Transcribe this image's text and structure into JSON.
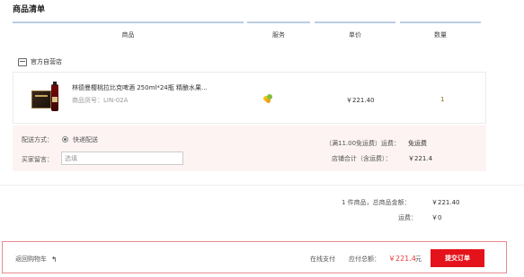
{
  "section_title": "商品清单",
  "columns": {
    "products": "商品",
    "service": "服务",
    "price": "单价",
    "qty": "数量"
  },
  "store": {
    "name": "官方自营店"
  },
  "item": {
    "name": "林德曼樱桃拉比克啤酒 250ml*24瓶 精酿水果...",
    "code": "商品货号：LIN-02A",
    "price": "￥221.40",
    "qty": "1"
  },
  "shipping": {
    "method_label": "配送方式：",
    "method_value": "快递配送",
    "memo_label": "买家留言：",
    "memo_placeholder": "选填",
    "fee_label": "（满11.00免运费）运费：",
    "fee_value": "免运费",
    "store_total_label": "店铺合计（含运费）：",
    "store_total_value": "￥221.4"
  },
  "summary": {
    "goods_label": "1 件商品，总商品金额：",
    "goods_value": "￥221.40",
    "freight_label": "运费：",
    "freight_value": "￥0"
  },
  "footer": {
    "back_label": "返回购物车",
    "pay_method": "在线支付",
    "total_label": "应付总额：",
    "total_value": "￥221.4",
    "total_unit": "元",
    "submit_label": "提交订单"
  },
  "colors": {
    "accent_red": "#e4121a",
    "price_red": "#e4393c",
    "header_rule": "#b9cde5",
    "shipping_bg": "#fdf3f3"
  }
}
